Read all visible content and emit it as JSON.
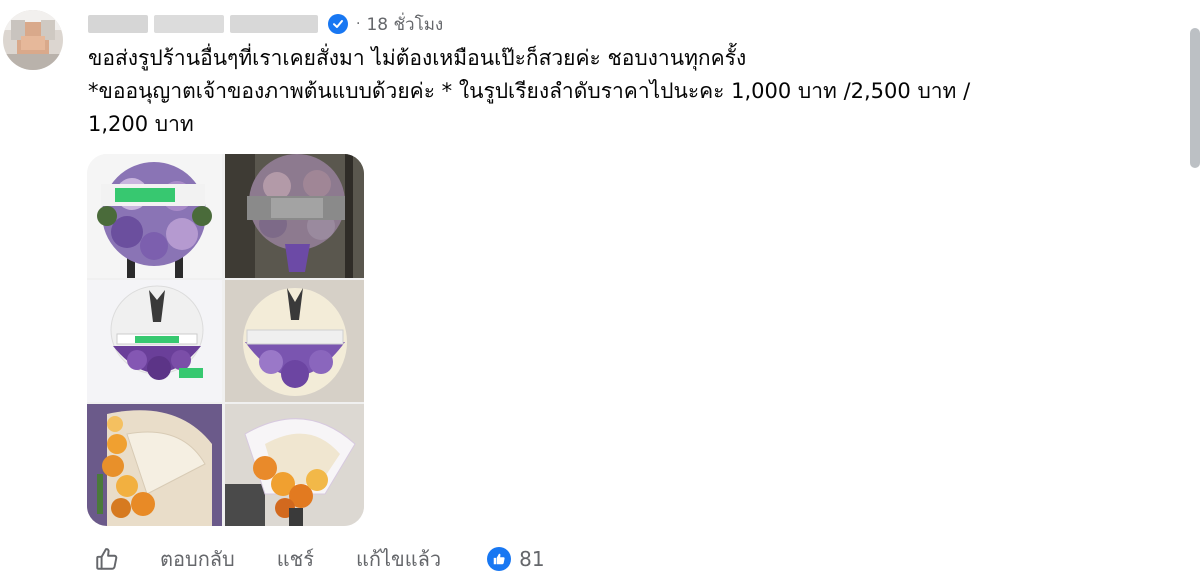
{
  "post": {
    "time": "18 ชั่วโมง",
    "dot": "·",
    "lines": [
      "ขอส่งรูปร้านอื่นๆที่เราเคยสั่งมา ไม่ต้องเหมือนเป๊ะก็สวยค่ะ ชอบงานทุกครั้ง",
      "*ขออนุญาตเจ้าของภาพต้นแบบด้วยค่ะ * ในรูปเรียงลำดับราคาไปนะคะ 1,000 บาท /2,500 บาท /",
      "1,200 บาท"
    ],
    "photos": [
      "purple-wreath-with-white-banner",
      "purple-wreath-on-stand",
      "white-purple-wreath-with-ribbon",
      "white-purple-wreath-on-easel",
      "sunflower-fan-wreath",
      "white-orange-fan-wreath"
    ]
  },
  "actions": {
    "reply": "ตอบกลับ",
    "share": "แชร์",
    "edited": "แก้ไขแล้ว",
    "reaction_count": "81"
  },
  "icons": {
    "verified": "verified-badge-icon",
    "like": "thumbs-up-icon",
    "reaction": "like-reaction-icon"
  },
  "colors": {
    "brand_blue": "#1877f2",
    "secondary_text": "#65676b",
    "primary_text": "#050505"
  }
}
